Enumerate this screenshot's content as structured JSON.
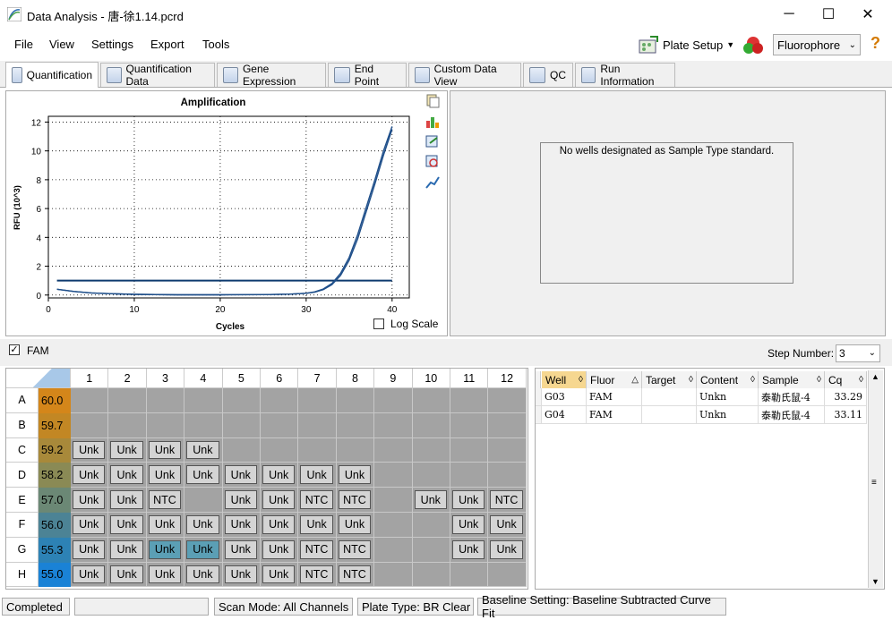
{
  "window": {
    "title": "Data Analysis - 唐-徐1.14.pcrd",
    "minimize": "─",
    "maximize": "☐",
    "close": "✕"
  },
  "menu": {
    "items": [
      "File",
      "View",
      "Settings",
      "Export",
      "Tools"
    ]
  },
  "toolbar": {
    "plate_setup": "Plate Setup",
    "fluorophore": "Fluorophore",
    "help": "?"
  },
  "tabs": [
    "Quantification",
    "Quantification Data",
    "Gene Expression",
    "End Point",
    "Custom Data View",
    "QC",
    "Run Information"
  ],
  "chart": {
    "title": "Amplification",
    "xlabel": "Cycles",
    "ylabel": "RFU (10^3)",
    "log_scale_label": "Log Scale"
  },
  "chart_data": {
    "type": "line",
    "title": "Amplification",
    "xlabel": "Cycles",
    "ylabel": "RFU (10^3)",
    "xlim": [
      0,
      42
    ],
    "ylim": [
      -0.2,
      12.4
    ],
    "xticks": [
      0,
      10,
      20,
      30,
      40
    ],
    "yticks": [
      0,
      2,
      4,
      6,
      8,
      10,
      12
    ],
    "grid": true,
    "threshold": 1.0,
    "series": [
      {
        "x": [
          1,
          3,
          5,
          8,
          10,
          15,
          20,
          25,
          28,
          30,
          31,
          32,
          33,
          34,
          35,
          36,
          37,
          38,
          39,
          40
        ],
        "values": [
          0.4,
          0.25,
          0.15,
          0.08,
          0.05,
          0.02,
          0.02,
          0.03,
          0.06,
          0.12,
          0.22,
          0.42,
          0.8,
          1.5,
          2.6,
          4.2,
          6.1,
          8.0,
          10.0,
          11.7
        ]
      },
      {
        "x": [
          1,
          3,
          5,
          8,
          10,
          15,
          20,
          25,
          28,
          30,
          31,
          32,
          33,
          34,
          35,
          36,
          37,
          38,
          39,
          40
        ],
        "values": [
          0.4,
          0.25,
          0.15,
          0.08,
          0.05,
          0.02,
          0.02,
          0.03,
          0.06,
          0.12,
          0.2,
          0.38,
          0.72,
          1.35,
          2.4,
          3.9,
          5.8,
          7.7,
          9.7,
          11.5
        ]
      }
    ]
  },
  "right_panel": {
    "message": "No wells designated as Sample Type standard."
  },
  "channel": {
    "label": "FAM",
    "checked": true,
    "step_label": "Step Number:",
    "step_value": "3"
  },
  "plate": {
    "columns": [
      "1",
      "2",
      "3",
      "4",
      "5",
      "6",
      "7",
      "8",
      "9",
      "10",
      "11",
      "12"
    ],
    "rows": [
      {
        "label": "A",
        "temp": "60.0",
        "color": "#d4861a",
        "wells": [
          "",
          "",
          "",
          "",
          "",
          "",
          "",
          "",
          "",
          "",
          "",
          ""
        ]
      },
      {
        "label": "B",
        "temp": "59.7",
        "color": "#c28724",
        "wells": [
          "",
          "",
          "",
          "",
          "",
          "",
          "",
          "",
          "",
          "",
          "",
          ""
        ]
      },
      {
        "label": "C",
        "temp": "59.2",
        "color": "#a8893a",
        "wells": [
          "Unk",
          "Unk",
          "Unk",
          "Unk",
          "",
          "",
          "",
          "",
          "",
          "",
          "",
          ""
        ]
      },
      {
        "label": "D",
        "temp": "58.2",
        "color": "#8a8a55",
        "wells": [
          "Unk",
          "Unk",
          "Unk",
          "Unk",
          "Unk",
          "Unk",
          "Unk",
          "Unk",
          "",
          "",
          "",
          ""
        ]
      },
      {
        "label": "E",
        "temp": "57.0",
        "color": "#6b8875",
        "wells": [
          "Unk",
          "Unk",
          "NTC",
          "",
          "Unk",
          "Unk",
          "NTC",
          "NTC",
          "",
          "Unk",
          "Unk",
          "NTC"
        ]
      },
      {
        "label": "F",
        "temp": "56.0",
        "color": "#4c8395",
        "wells": [
          "Unk",
          "Unk",
          "Unk",
          "Unk",
          "Unk",
          "Unk",
          "Unk",
          "Unk",
          "",
          "",
          "Unk",
          "Unk"
        ]
      },
      {
        "label": "G",
        "temp": "55.3",
        "color": "#2d82b5",
        "wells": [
          "Unk",
          "Unk",
          "Unk",
          "Unk",
          "Unk",
          "Unk",
          "NTC",
          "NTC",
          "",
          "",
          "Unk",
          "Unk"
        ]
      },
      {
        "label": "H",
        "temp": "55.0",
        "color": "#1a82d6",
        "wells": [
          "Unk",
          "Unk",
          "Unk",
          "Unk",
          "Unk",
          "Unk",
          "NTC",
          "NTC",
          "",
          "",
          "",
          ""
        ]
      }
    ]
  },
  "table": {
    "headers": [
      "Well",
      "Fluor",
      "Target",
      "Content",
      "Sample",
      "Cq"
    ],
    "rows": [
      [
        "G03",
        "FAM",
        "",
        "Unkn",
        "泰勒氏鼠-4",
        "33.29"
      ],
      [
        "G04",
        "FAM",
        "",
        "Unkn",
        "泰勒氏鼠-4",
        "33.11"
      ]
    ]
  },
  "status": {
    "state": "Completed",
    "scan_mode": "Scan Mode: All Channels",
    "plate_type": "Plate Type: BR Clear",
    "baseline": "Baseline Setting: Baseline Subtracted Curve Fit"
  }
}
